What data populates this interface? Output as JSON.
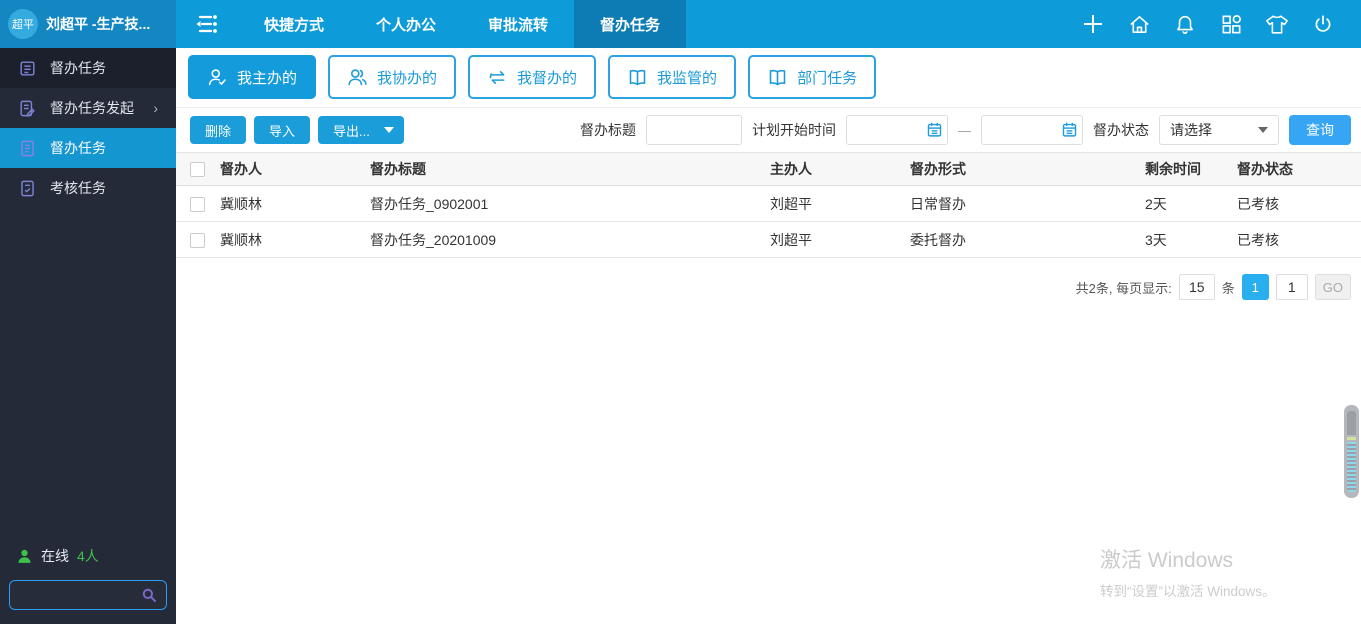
{
  "topbar": {
    "avatar_text": "超平",
    "user_name": "刘超平 -生产技...",
    "tabs": [
      {
        "label": "快捷方式",
        "active": false
      },
      {
        "label": "个人办公",
        "active": false
      },
      {
        "label": "审批流转",
        "active": false
      },
      {
        "label": "督办任务",
        "active": true
      }
    ],
    "icons": [
      "plus-icon",
      "home-icon",
      "bell-icon",
      "apps-icon",
      "tshirt-icon",
      "power-icon"
    ]
  },
  "sidebar": {
    "items": [
      {
        "label": "督办任务",
        "active": false
      },
      {
        "label": "督办任务发起",
        "active": false,
        "has_submenu": true,
        "arrow": "›"
      },
      {
        "label": "督办任务",
        "active": true
      },
      {
        "label": "考核任务",
        "active": false
      }
    ],
    "online_label": "在线",
    "online_count": "4人",
    "search_value": ""
  },
  "filters": {
    "tabs": [
      {
        "label": "我主办的",
        "icon": "user-check-icon",
        "active": true
      },
      {
        "label": "我协办的",
        "icon": "users-icon",
        "active": false
      },
      {
        "label": "我督办的",
        "icon": "swap-arrows-icon",
        "active": false
      },
      {
        "label": "我监管的",
        "icon": "open-book-icon",
        "active": false
      },
      {
        "label": "部门任务",
        "icon": "open-book-icon",
        "active": false
      }
    ]
  },
  "toolbar": {
    "delete_label": "删除",
    "import_label": "导入",
    "export_label": "导出...",
    "title_label": "督办标题",
    "title_value": "",
    "date_label": "计划开始时间",
    "date_from": "",
    "date_to": "",
    "date_separator": "—",
    "status_label": "督办状态",
    "status_value": "请选择",
    "query_label": "查询"
  },
  "table": {
    "columns": [
      "督办人",
      "督办标题",
      "主办人",
      "督办形式",
      "剩余时间",
      "督办状态"
    ],
    "rows": [
      [
        "冀顺林",
        "督办任务_0902001",
        "刘超平",
        "日常督办",
        "2天",
        "已考核"
      ],
      [
        "冀顺林",
        "督办任务_20201009",
        "刘超平",
        "委托督办",
        "3天",
        "已考核"
      ]
    ]
  },
  "pagination": {
    "summary": "共2条, 每页显示:",
    "page_size": "15",
    "unit": "条",
    "current_page": "1",
    "jump_value": "1",
    "go_label": "GO"
  },
  "watermark": {
    "title": "激活 Windows",
    "subtitle": "转到“设置”以激活 Windows。"
  },
  "colors": {
    "topbar_blue": "#0d9bd9",
    "topbar_user_segment": "#1487c2",
    "topbar_active_tab": "#0d7cb5",
    "sidebar_bg": "#242a38",
    "sidebar_active": "#1496d1",
    "accent_button": "#1b9dd9",
    "query_button": "#36a5f3",
    "online_green": "#3ec14a",
    "current_page_blue": "#29aef0"
  }
}
